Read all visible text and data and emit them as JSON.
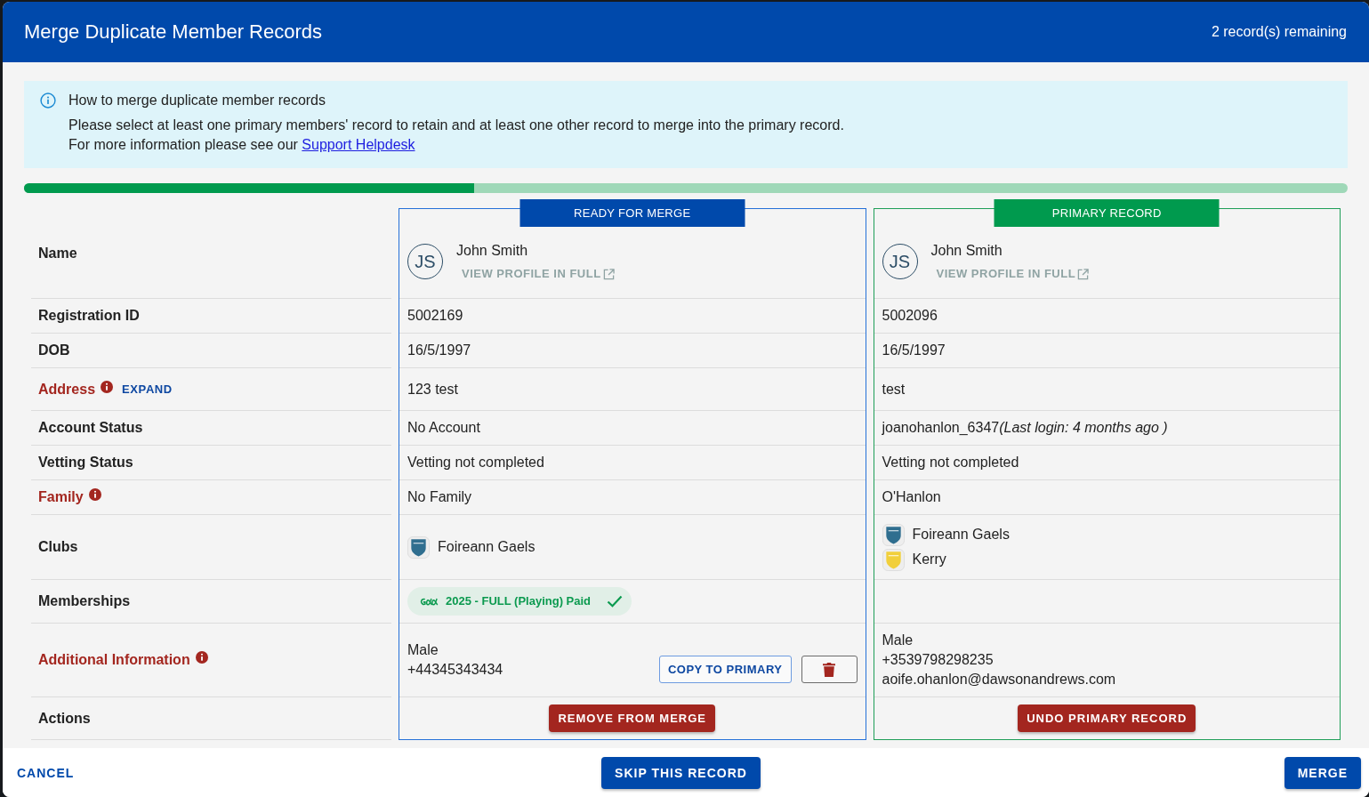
{
  "dialog": {
    "title": "Merge Duplicate Member Records",
    "remaining": "2 record(s) remaining"
  },
  "info": {
    "title": "How to merge duplicate member records",
    "text": "Please select at least one primary members' record to retain and at least one other record to merge into the primary record.",
    "more": "For more information please see our",
    "link": "Support Helpdesk"
  },
  "progress": {
    "level": 0.34
  },
  "table": {
    "rows": [
      {
        "label": "Name",
        "kind": "name",
        "warning": false
      },
      {
        "label": "Registration ID",
        "kind": "text",
        "warning": false
      },
      {
        "label": "DOB",
        "kind": "text",
        "warning": false
      },
      {
        "label": "Address",
        "kind": "text",
        "warning": true,
        "action": "EXPAND"
      },
      {
        "label": "Account Status",
        "kind": "text",
        "warning": false
      },
      {
        "label": "Vetting Status",
        "kind": "text",
        "warning": false
      },
      {
        "label": "Family",
        "kind": "text",
        "warning": true
      },
      {
        "label": "Clubs",
        "kind": "clubs",
        "warning": false
      },
      {
        "label": "Memberships",
        "kind": "memberships",
        "warning": false
      },
      {
        "label": "Additional Information",
        "kind": "details",
        "warning": true
      },
      {
        "label": "Actions",
        "kind": "actions",
        "warning": false
      }
    ],
    "records": [
      {
        "tag": "READY FOR MERGE",
        "kind": "merge",
        "cells": [
          {
            "initials": "JS",
            "name": "John Smith",
            "link": "VIEW PROFILE IN FULL"
          },
          {
            "text": "5002169"
          },
          {
            "text": "16/5/1997"
          },
          {
            "text": "123 test"
          },
          {
            "text": "No Account"
          },
          {
            "text": "Vetting not completed"
          },
          {
            "text": "No Family"
          },
          {
            "clubs": [
              {
                "name": "Foireann Gaels",
                "color": "#2f6e8f"
              }
            ]
          },
          {
            "memberships": [
              {
                "label": "2025 - FULL (Playing) Paid",
                "paid": true
              }
            ]
          },
          {
            "lines": [
              "Male",
              "+44345343434"
            ],
            "copy": "COPY TO PRIMARY",
            "deletable": true
          },
          {
            "button": "REMOVE FROM MERGE"
          }
        ]
      },
      {
        "tag": "PRIMARY RECORD",
        "kind": "primary",
        "cells": [
          {
            "initials": "JS",
            "name": "John Smith",
            "link": "VIEW PROFILE IN FULL"
          },
          {
            "text": "5002096"
          },
          {
            "text": "16/5/1997"
          },
          {
            "text": "test"
          },
          {
            "text": "joanohanlon_6347",
            "note": "(Last login: 4 months ago )"
          },
          {
            "text": "Vetting not completed"
          },
          {
            "text": "O'Hanlon"
          },
          {
            "clubs": [
              {
                "name": "Foireann Gaels",
                "color": "#2f6e8f"
              },
              {
                "name": "Kerry",
                "color": "#f1cf3b"
              }
            ]
          },
          {},
          {
            "lines": [
              "Male",
              "+3539798298235",
              "aoife.ohanlon@dawsonandrews.com"
            ],
            "deletable": false
          },
          {
            "button": "UNDO PRIMARY RECORD"
          }
        ]
      }
    ]
  },
  "footer": {
    "buttons": [
      {
        "label": "CANCEL",
        "kind": "text"
      },
      {
        "label": "SKIP THIS RECORD",
        "kind": "filled"
      },
      {
        "label": "MERGE",
        "kind": "filled"
      }
    ]
  }
}
